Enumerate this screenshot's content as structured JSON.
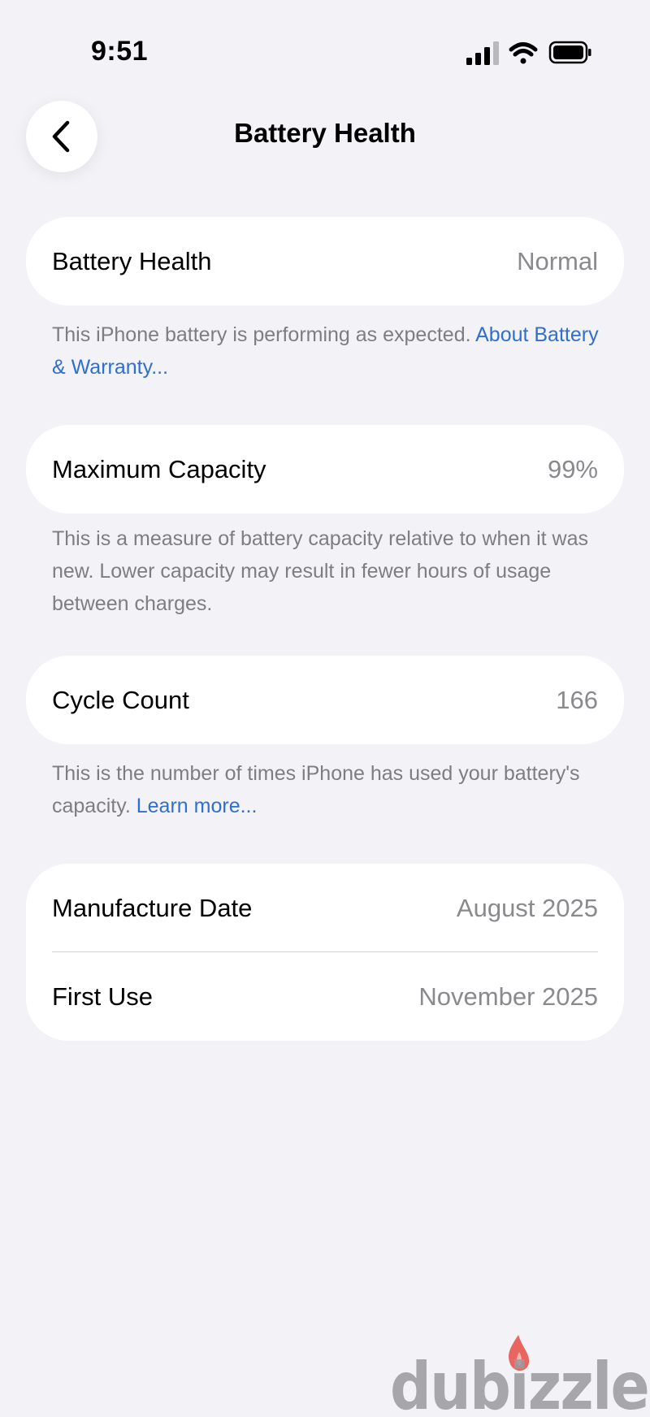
{
  "status_bar": {
    "time": "9:51",
    "icons": [
      "cellular-signal-icon",
      "wifi-icon",
      "battery-icon"
    ]
  },
  "nav": {
    "back_icon": "chevron-left-icon",
    "title": "Battery Health"
  },
  "battery_health": {
    "label": "Battery Health",
    "value": "Normal",
    "footnote_text": "This iPhone battery is performing as expected. ",
    "footnote_link": "About Battery & Warranty..."
  },
  "maximum_capacity": {
    "label": "Maximum Capacity",
    "value": "99%",
    "footnote_text": "This is a measure of battery capacity relative to when it was new. Lower capacity may result in fewer hours of usage between charges."
  },
  "cycle_count": {
    "label": "Cycle Count",
    "value": "166",
    "footnote_text": "This is the number of times iPhone has used your battery's capacity. ",
    "footnote_link": "Learn more..."
  },
  "dates": {
    "manufacture_label": "Manufacture Date",
    "manufacture_value": "August 2025",
    "first_use_label": "First Use",
    "first_use_value": "November 2025"
  },
  "watermark": {
    "text": "dubizzle"
  },
  "colors": {
    "background": "#f2f2f7",
    "card": "#ffffff",
    "link": "#2f6fce",
    "secondary_text": "#8a8a8e",
    "watermark_flame": "#e8554e"
  }
}
